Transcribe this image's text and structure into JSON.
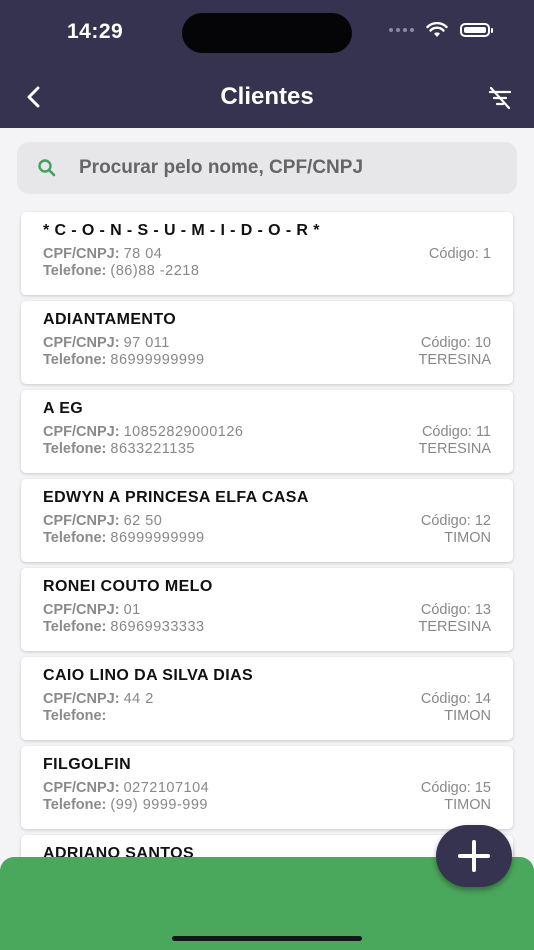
{
  "status_bar": {
    "time": "14:29"
  },
  "header": {
    "title": "Clientes"
  },
  "search": {
    "placeholder": "Procurar pelo nome, CPF/CNPJ"
  },
  "labels": {
    "cpf": "CPF/CNPJ:",
    "phone": "Telefone:"
  },
  "clients": [
    {
      "name": "* C - O - N - S - U - M - I - D - O - R *",
      "cpf": "78            04",
      "phone": "(86)88     -2218",
      "code": "Código: 1",
      "city": ""
    },
    {
      "name": "ADIANTAMENTO",
      "cpf": "97              011",
      "phone": "86999999999",
      "code": "Código: 10",
      "city": "TERESINA"
    },
    {
      "name": "A                                           EG",
      "cpf": "10852829000126",
      "phone": "8633221135",
      "code": "Código: 11",
      "city": "TERESINA"
    },
    {
      "name": "EDWYN A PRINCESA ELFA CASA",
      "cpf": "62              50",
      "phone": "86999999999",
      "code": "Código: 12",
      "city": "TIMON"
    },
    {
      "name": "RONEI COUTO MELO",
      "cpf": "01",
      "phone": "86969933333",
      "code": "Código: 13",
      "city": "TERESINA"
    },
    {
      "name": "CAIO LINO DA SILVA DIAS",
      "cpf": "44                    2",
      "phone": "",
      "code": "Código: 14",
      "city": "TIMON"
    },
    {
      "name": "FILGOLFIN",
      "cpf": "0272107104",
      "phone": "(99) 9999-999",
      "code": "Código: 15",
      "city": "TIMON"
    },
    {
      "name": "ADRIANO SANTOS",
      "cpf": "",
      "phone": "",
      "code": "",
      "city": ""
    }
  ],
  "colors": {
    "header": "#35334f",
    "bottom_bar": "#4aa85c",
    "search_icon": "#3fa35a"
  },
  "icons": {
    "back": "chevron-left-icon",
    "filter": "filter-off-icon",
    "search": "search-icon",
    "fab": "plus-icon"
  }
}
